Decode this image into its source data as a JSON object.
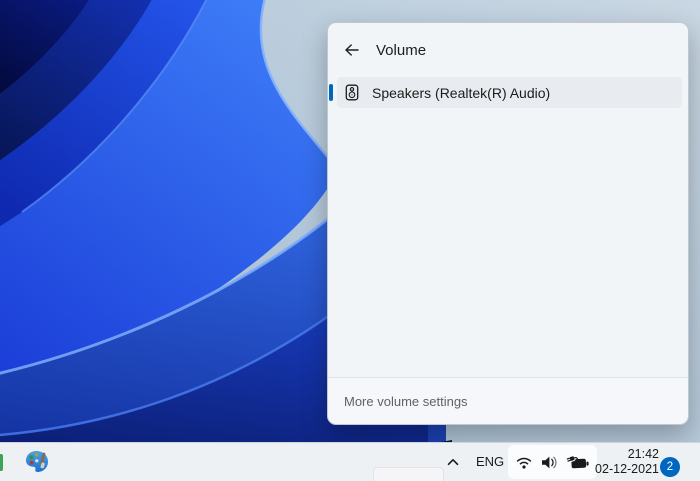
{
  "colors": {
    "accent": "#0067c0",
    "flyout_background": "#f2f5f8",
    "selected_row_background": "#e8ecf0",
    "taskbar_background": "#eef1f4"
  },
  "flyout": {
    "title": "Volume",
    "back_icon": "arrow-left",
    "device": {
      "label": "Speakers (Realtek(R) Audio)",
      "selected": true,
      "icon": "speaker-device-icon"
    },
    "footer_link": "More volume settings"
  },
  "taskbar": {
    "language_label": "ENG",
    "clock": {
      "time": "21:42",
      "date": "02-12-2021"
    },
    "notification_badge": "2",
    "tray_icons": [
      "wifi-icon",
      "volume-icon",
      "battery-charging-icon"
    ],
    "left_icons": [
      "partial-app-icon",
      "paint-icon"
    ],
    "chevron_icon": "hidden-icons-chevron"
  }
}
